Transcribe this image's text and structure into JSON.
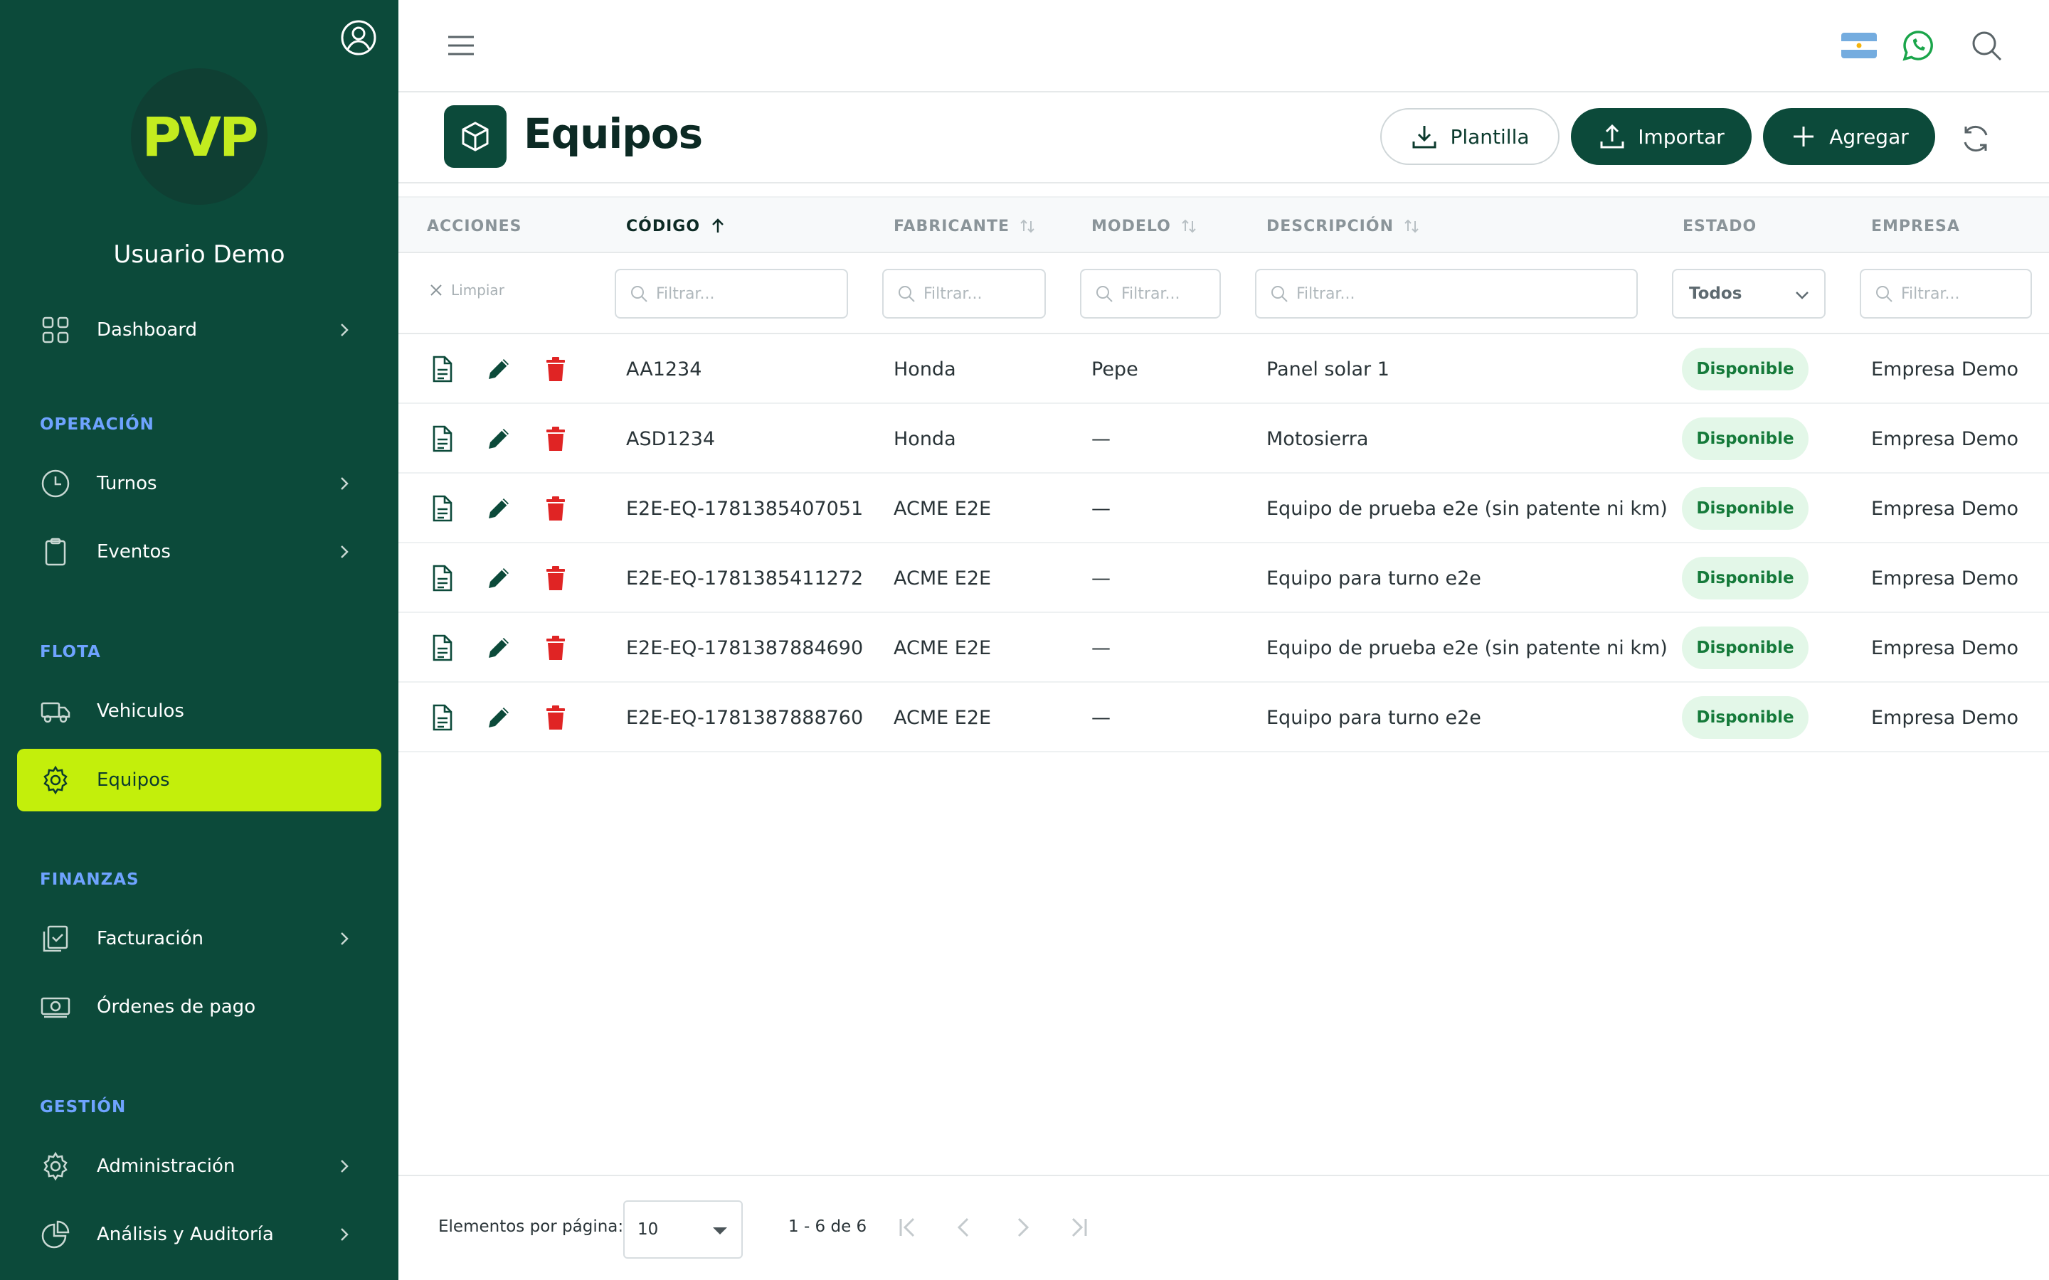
{
  "sidebar": {
    "logo_text": "PVP",
    "username": "Usuario Demo",
    "items": {
      "dashboard": "Dashboard",
      "turnos": "Turnos",
      "eventos": "Eventos",
      "vehiculos": "Vehiculos",
      "equipos": "Equipos",
      "facturacion": "Facturación",
      "ordenes": "Órdenes de pago",
      "administracion": "Administración",
      "analisis": "Análisis y Auditoría"
    },
    "sections": {
      "operacion": "OPERACIÓN",
      "flota": "FLOTA",
      "finanzas": "FINANZAS",
      "gestion": "GESTIÓN"
    },
    "active_item": "Equipos"
  },
  "header": {
    "title": "Equipos",
    "buttons": {
      "plantilla": "Plantilla",
      "importar": "Importar",
      "agregar": "Agregar"
    }
  },
  "table": {
    "columns": {
      "acciones": "ACCIONES",
      "codigo": "CÓDIGO",
      "fabricante": "FABRICANTE",
      "modelo": "MODELO",
      "descripcion": "DESCRIPCIÓN",
      "estado": "ESTADO",
      "empresa": "EMPRESA"
    },
    "clear_filters": "Limpiar",
    "filter_placeholder": "Filtrar...",
    "estado_filter_value": "Todos",
    "rows": [
      {
        "codigo": "AA1234",
        "fabricante": "Honda",
        "modelo": "Pepe",
        "descripcion": "Panel solar 1",
        "estado": "Disponible",
        "empresa": "Empresa Demo"
      },
      {
        "codigo": "ASD1234",
        "fabricante": "Honda",
        "modelo": "—",
        "descripcion": "Motosierra",
        "estado": "Disponible",
        "empresa": "Empresa Demo"
      },
      {
        "codigo": "E2E-EQ-1781385407051",
        "fabricante": "ACME E2E",
        "modelo": "—",
        "descripcion": "Equipo de prueba e2e (sin patente ni km)",
        "estado": "Disponible",
        "empresa": "Empresa Demo"
      },
      {
        "codigo": "E2E-EQ-1781385411272",
        "fabricante": "ACME E2E",
        "modelo": "—",
        "descripcion": "Equipo para turno e2e",
        "estado": "Disponible",
        "empresa": "Empresa Demo"
      },
      {
        "codigo": "E2E-EQ-1781387884690",
        "fabricante": "ACME E2E",
        "modelo": "—",
        "descripcion": "Equipo de prueba e2e (sin patente ni km)",
        "estado": "Disponible",
        "empresa": "Empresa Demo"
      },
      {
        "codigo": "E2E-EQ-1781387888760",
        "fabricante": "ACME E2E",
        "modelo": "—",
        "descripcion": "Equipo para turno e2e",
        "estado": "Disponible",
        "empresa": "Empresa Demo"
      }
    ]
  },
  "footer": {
    "per_page_label": "Elementos por página:",
    "per_page_value": "10",
    "range": "1 - 6 de 6"
  },
  "colors": {
    "sidebar_bg": "#0c4a3a",
    "accent": "#c3ef0b",
    "section_label": "#6fa3ff",
    "delete": "#e02424",
    "badge_bg": "#e3f7e8",
    "badge_text": "#157a3a"
  },
  "icons": {
    "topbar": [
      "menu-icon",
      "argentina-flag-icon",
      "whatsapp-icon",
      "search-icon"
    ],
    "row_actions": [
      "document-icon",
      "edit-pencil-icon",
      "trash-icon"
    ]
  }
}
